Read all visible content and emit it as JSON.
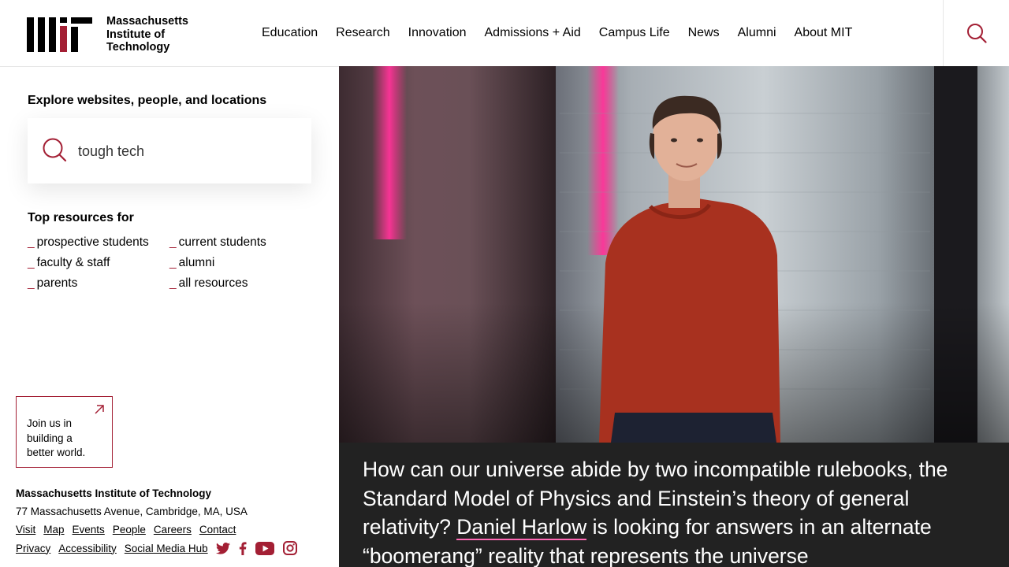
{
  "brand": {
    "name_line1": "Massachusetts",
    "name_line2": "Institute of",
    "name_line3": "Technology",
    "accent": "#a31f34"
  },
  "nav": {
    "items": [
      {
        "label": "Education"
      },
      {
        "label": "Research"
      },
      {
        "label": "Innovation"
      },
      {
        "label": "Admissions + Aid"
      },
      {
        "label": "Campus Life"
      },
      {
        "label": "News"
      },
      {
        "label": "Alumni"
      },
      {
        "label": "About MIT"
      }
    ],
    "search_icon": "search-icon"
  },
  "explore": {
    "title": "Explore websites, people, and locations",
    "search_value": "tough tech"
  },
  "resources": {
    "title": "Top resources for",
    "items": [
      {
        "label": "prospective students"
      },
      {
        "label": "current students"
      },
      {
        "label": "faculty & staff"
      },
      {
        "label": "alumni"
      },
      {
        "label": "parents"
      },
      {
        "label": "all resources"
      }
    ]
  },
  "join": {
    "label": "Join us in building a better world.",
    "icon": "external-arrow-icon"
  },
  "footer": {
    "name": "Massachusetts Institute of Technology",
    "address": "77 Massachusetts Avenue, Cambridge, MA, USA",
    "links_row1": [
      "Visit",
      "Map",
      "Events",
      "People",
      "Careers",
      "Contact"
    ],
    "links_row2": [
      "Privacy",
      "Accessibility",
      "Social Media Hub"
    ],
    "social_icons": [
      "twitter-icon",
      "facebook-icon",
      "youtube-icon",
      "instagram-icon"
    ]
  },
  "hero": {
    "caption_before": "How can our universe abide by two incompatible rulebooks, the Standard Model of Physics and Einstein’s theory of general relativity? ",
    "caption_link": "Daniel Harlow",
    "caption_after": " is looking for answers in an alternate “boomerang” reality that represents the universe"
  }
}
